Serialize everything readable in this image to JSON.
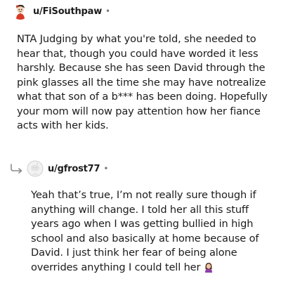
{
  "comments": [
    {
      "username": "u/FiSouthpaw",
      "separator": "•",
      "avatar_icon": "snoo-avatar-red-shirt",
      "body": "NTA Judging by what you're told, she needed to hear that, though you could have worded it less harshly. Because she has seen David through the pink glasses all the time she may have notrealize what that son of a b*** has been doing. Hopefully your mom will now pay attention how her fiance acts with her kids."
    },
    {
      "username": "u/gfrost77",
      "separator": "•",
      "avatar_icon": "default-snoo-avatar",
      "reply_icon": "reply-arrow-icon",
      "body": "Yeah that’s true, I’m not really sure though if anything will change. I told her all this stuff years ago when I was getting bullied in high school and also basically at home because of David. I just think her fear of being alone overrides anything I could tell her",
      "trailing_emoji": "woman-facepalming-emoji"
    }
  ],
  "colors": {
    "text": "#1c1c1c",
    "meta": "#7c7c7c",
    "avatar_shirt": "#d93a26",
    "emoji_purple": "#8e3fa6"
  }
}
